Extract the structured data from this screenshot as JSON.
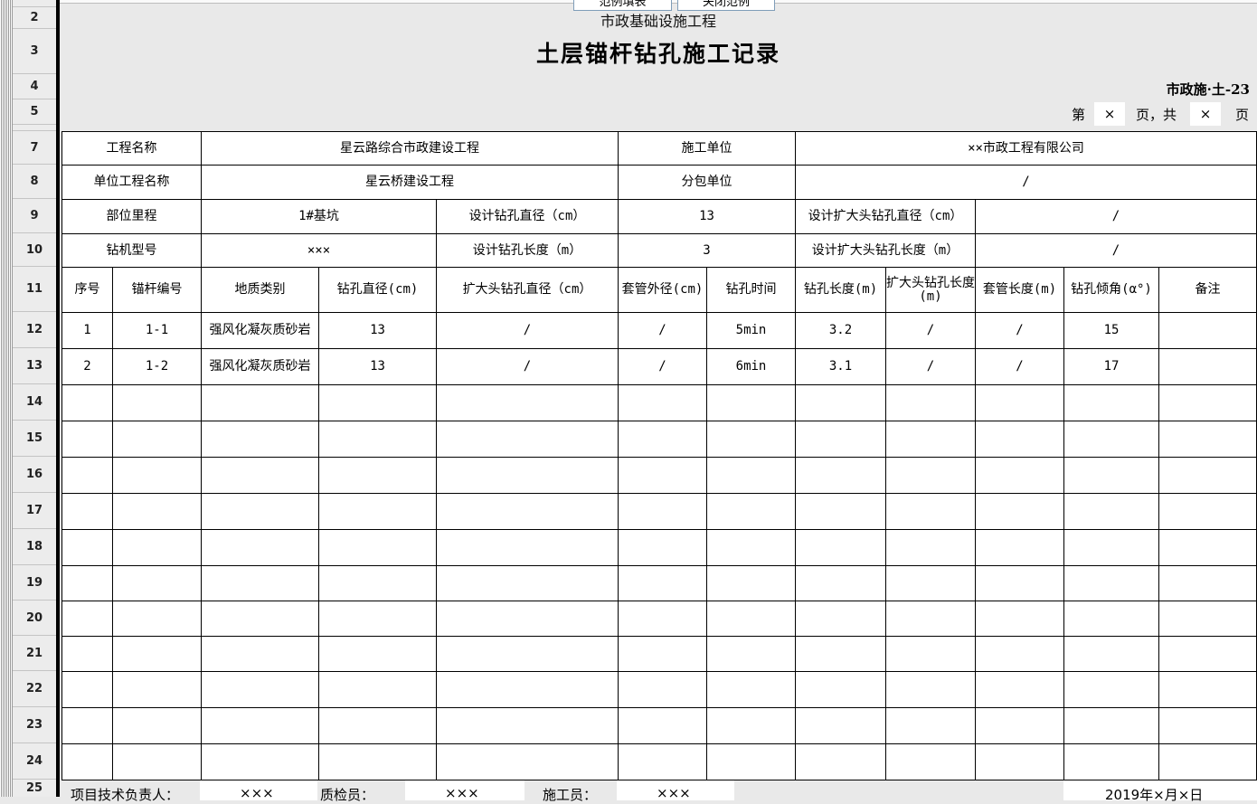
{
  "toolbar": {
    "btn1": "范例填表",
    "btn2": "关闭范例"
  },
  "row_numbers": [
    "2",
    "3",
    "4",
    "5",
    "7",
    "8",
    "9",
    "10",
    "11",
    "12",
    "13",
    "14",
    "15",
    "16",
    "17",
    "18",
    "19",
    "20",
    "21",
    "22",
    "23",
    "24",
    "25"
  ],
  "doc": {
    "subtitle": "市政基础设施工程",
    "title": "土层锚杆钻孔施工记录",
    "code": "市政施·土-23",
    "page_label_1": "第",
    "page_cur": "×",
    "page_label_2": "页，共",
    "page_total": "×",
    "page_label_3": "页"
  },
  "info": {
    "project_name_label": "工程名称",
    "project_name": "星云路综合市政建设工程",
    "contractor_label": "施工单位",
    "contractor": "××市政工程有限公司",
    "unit_name_label": "单位工程名称",
    "unit_name": "星云桥建设工程",
    "subcontractor_label": "分包单位",
    "subcontractor": "/",
    "location_label": "部位里程",
    "location": "1#基坑",
    "design_dia_label": "设计钻孔直径（cm）",
    "design_dia": "13",
    "design_exp_dia_label": "设计扩大头钻孔直径（cm）",
    "design_exp_dia": "/",
    "rig_label": "钻机型号",
    "rig": "×××",
    "design_len_label": "设计钻孔长度（m）",
    "design_len": "3",
    "design_exp_len_label": "设计扩大头钻孔长度（m）",
    "design_exp_len": "/"
  },
  "columns": {
    "seq": "序号",
    "anchor": "锚杆编号",
    "geo": "地质类别",
    "dia": "钻孔直径(cm)",
    "exp_dia": "扩大头钻孔直径（cm）",
    "casing_dia": "套管外径(cm)",
    "time": "钻孔时间",
    "len": "钻孔长度(m)",
    "exp_len": "扩大头钻孔长度(m)",
    "casing_len": "套管长度(m)",
    "angle": "钻孔倾角(α°)",
    "remark": "备注"
  },
  "rows": [
    {
      "seq": "1",
      "anchor": "1-1",
      "geo": "强风化凝灰质砂岩",
      "dia": "13",
      "exp_dia": "/",
      "casing_dia": "/",
      "time": "5min",
      "len": "3.2",
      "exp_len": "/",
      "casing_len": "/",
      "angle": "15",
      "remark": ""
    },
    {
      "seq": "2",
      "anchor": "1-2",
      "geo": "强风化凝灰质砂岩",
      "dia": "13",
      "exp_dia": "/",
      "casing_dia": "/",
      "time": "6min",
      "len": "3.1",
      "exp_len": "/",
      "casing_len": "/",
      "angle": "17",
      "remark": ""
    }
  ],
  "footer": {
    "tech_lead_label": "项目技术负责人：",
    "tech_lead": "×××",
    "qc_label": "质检员：",
    "qc": "×××",
    "worker_label": "施工员：",
    "worker": "×××",
    "date": "2019年×月×日"
  }
}
